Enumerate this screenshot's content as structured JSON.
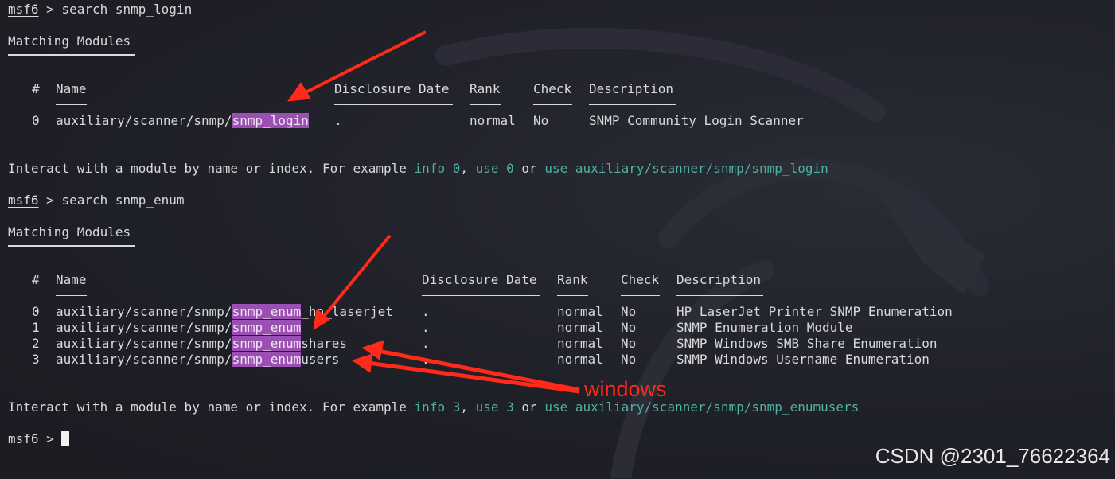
{
  "prompt": {
    "name": "msf6",
    "sep": " > "
  },
  "block1": {
    "command": "search snmp_login",
    "heading": "Matching Modules",
    "headers": {
      "num": "#",
      "name": "Name",
      "date": "Disclosure Date",
      "rank": "Rank",
      "check": "Check",
      "desc": "Description"
    },
    "rows": [
      {
        "num": "0",
        "path": "auxiliary/scanner/snmp/",
        "match": "snmp_login",
        "rest": "",
        "date": ".",
        "rank": "normal",
        "check": "No",
        "desc": "SNMP Community Login Scanner"
      }
    ],
    "interact": {
      "prefix": "Interact with a module by name or index. For example ",
      "info": "info 0",
      "comma": ", ",
      "use": "use 0",
      "or": " or ",
      "use_full": "use auxiliary/scanner/snmp/snmp_login"
    }
  },
  "block2": {
    "command": "search snmp_enum",
    "heading": "Matching Modules",
    "headers": {
      "num": "#",
      "name": "Name",
      "date": "Disclosure Date",
      "rank": "Rank",
      "check": "Check",
      "desc": "Description"
    },
    "rows": [
      {
        "num": "0",
        "path": "auxiliary/scanner/snmp/",
        "match": "snmp_enum",
        "rest": "_hp_laserjet",
        "date": ".",
        "rank": "normal",
        "check": "No",
        "desc": "HP LaserJet Printer SNMP Enumeration"
      },
      {
        "num": "1",
        "path": "auxiliary/scanner/snmp/",
        "match": "snmp_enum",
        "rest": "",
        "date": ".",
        "rank": "normal",
        "check": "No",
        "desc": "SNMP Enumeration Module"
      },
      {
        "num": "2",
        "path": "auxiliary/scanner/snmp/",
        "match": "snmp_enum",
        "rest": "shares",
        "date": ".",
        "rank": "normal",
        "check": "No",
        "desc": "SNMP Windows SMB Share Enumeration"
      },
      {
        "num": "3",
        "path": "auxiliary/scanner/snmp/",
        "match": "snmp_enum",
        "rest": "users",
        "date": ".",
        "rank": "normal",
        "check": "No",
        "desc": "SNMP Windows Username Enumeration"
      }
    ],
    "interact": {
      "prefix": "Interact with a module by name or index. For example ",
      "info": "info 3",
      "comma": ", ",
      "use": "use 3",
      "or": " or ",
      "use_full": "use auxiliary/scanner/snmp/snmp_enumusers"
    }
  },
  "annotation": {
    "text": "windows",
    "color": "#ff2a1a"
  },
  "watermark": "CSDN @2301_76622364",
  "colors": {
    "background": "#1f2028",
    "text": "#d9d9d9",
    "highlight": "#9b4fb3",
    "link": "#4fb1a1"
  }
}
